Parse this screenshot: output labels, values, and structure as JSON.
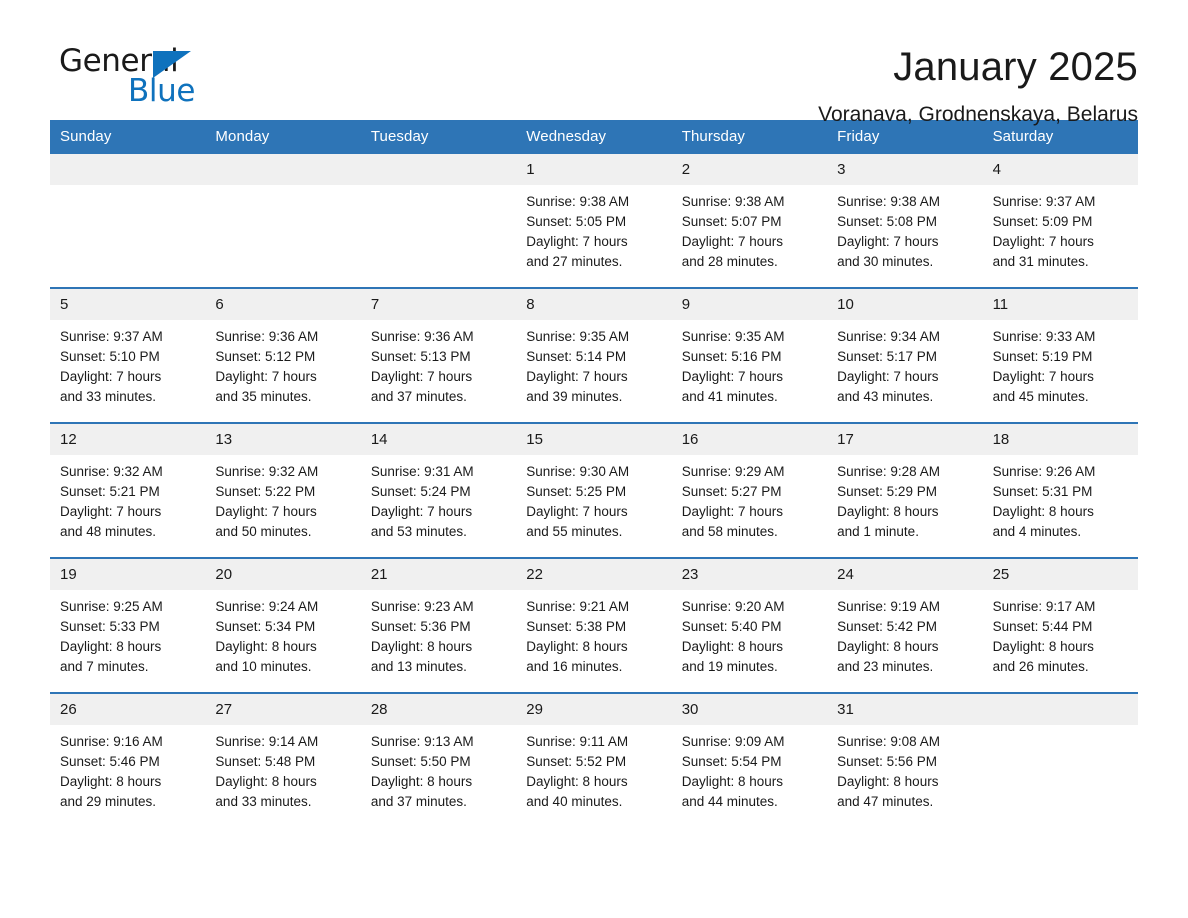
{
  "logo": {
    "word1": "General",
    "word2": "Blue",
    "triangle_icon": "triangle-icon",
    "accent_color": "#0f72bd"
  },
  "header": {
    "month_title": "January 2025",
    "location": "Voranava, Grodnenskaya, Belarus"
  },
  "theme": {
    "header_blue": "#2e75b6",
    "daynum_gray": "#f0f0f0",
    "text": "#1a1a1a"
  },
  "weekdays": [
    "Sunday",
    "Monday",
    "Tuesday",
    "Wednesday",
    "Thursday",
    "Friday",
    "Saturday"
  ],
  "weeks": [
    [
      {
        "day": "",
        "sunrise": "",
        "sunset": "",
        "daylight1": "",
        "daylight2": ""
      },
      {
        "day": "",
        "sunrise": "",
        "sunset": "",
        "daylight1": "",
        "daylight2": ""
      },
      {
        "day": "",
        "sunrise": "",
        "sunset": "",
        "daylight1": "",
        "daylight2": ""
      },
      {
        "day": "1",
        "sunrise": "Sunrise: 9:38 AM",
        "sunset": "Sunset: 5:05 PM",
        "daylight1": "Daylight: 7 hours",
        "daylight2": "and 27 minutes."
      },
      {
        "day": "2",
        "sunrise": "Sunrise: 9:38 AM",
        "sunset": "Sunset: 5:07 PM",
        "daylight1": "Daylight: 7 hours",
        "daylight2": "and 28 minutes."
      },
      {
        "day": "3",
        "sunrise": "Sunrise: 9:38 AM",
        "sunset": "Sunset: 5:08 PM",
        "daylight1": "Daylight: 7 hours",
        "daylight2": "and 30 minutes."
      },
      {
        "day": "4",
        "sunrise": "Sunrise: 9:37 AM",
        "sunset": "Sunset: 5:09 PM",
        "daylight1": "Daylight: 7 hours",
        "daylight2": "and 31 minutes."
      }
    ],
    [
      {
        "day": "5",
        "sunrise": "Sunrise: 9:37 AM",
        "sunset": "Sunset: 5:10 PM",
        "daylight1": "Daylight: 7 hours",
        "daylight2": "and 33 minutes."
      },
      {
        "day": "6",
        "sunrise": "Sunrise: 9:36 AM",
        "sunset": "Sunset: 5:12 PM",
        "daylight1": "Daylight: 7 hours",
        "daylight2": "and 35 minutes."
      },
      {
        "day": "7",
        "sunrise": "Sunrise: 9:36 AM",
        "sunset": "Sunset: 5:13 PM",
        "daylight1": "Daylight: 7 hours",
        "daylight2": "and 37 minutes."
      },
      {
        "day": "8",
        "sunrise": "Sunrise: 9:35 AM",
        "sunset": "Sunset: 5:14 PM",
        "daylight1": "Daylight: 7 hours",
        "daylight2": "and 39 minutes."
      },
      {
        "day": "9",
        "sunrise": "Sunrise: 9:35 AM",
        "sunset": "Sunset: 5:16 PM",
        "daylight1": "Daylight: 7 hours",
        "daylight2": "and 41 minutes."
      },
      {
        "day": "10",
        "sunrise": "Sunrise: 9:34 AM",
        "sunset": "Sunset: 5:17 PM",
        "daylight1": "Daylight: 7 hours",
        "daylight2": "and 43 minutes."
      },
      {
        "day": "11",
        "sunrise": "Sunrise: 9:33 AM",
        "sunset": "Sunset: 5:19 PM",
        "daylight1": "Daylight: 7 hours",
        "daylight2": "and 45 minutes."
      }
    ],
    [
      {
        "day": "12",
        "sunrise": "Sunrise: 9:32 AM",
        "sunset": "Sunset: 5:21 PM",
        "daylight1": "Daylight: 7 hours",
        "daylight2": "and 48 minutes."
      },
      {
        "day": "13",
        "sunrise": "Sunrise: 9:32 AM",
        "sunset": "Sunset: 5:22 PM",
        "daylight1": "Daylight: 7 hours",
        "daylight2": "and 50 minutes."
      },
      {
        "day": "14",
        "sunrise": "Sunrise: 9:31 AM",
        "sunset": "Sunset: 5:24 PM",
        "daylight1": "Daylight: 7 hours",
        "daylight2": "and 53 minutes."
      },
      {
        "day": "15",
        "sunrise": "Sunrise: 9:30 AM",
        "sunset": "Sunset: 5:25 PM",
        "daylight1": "Daylight: 7 hours",
        "daylight2": "and 55 minutes."
      },
      {
        "day": "16",
        "sunrise": "Sunrise: 9:29 AM",
        "sunset": "Sunset: 5:27 PM",
        "daylight1": "Daylight: 7 hours",
        "daylight2": "and 58 minutes."
      },
      {
        "day": "17",
        "sunrise": "Sunrise: 9:28 AM",
        "sunset": "Sunset: 5:29 PM",
        "daylight1": "Daylight: 8 hours",
        "daylight2": "and 1 minute."
      },
      {
        "day": "18",
        "sunrise": "Sunrise: 9:26 AM",
        "sunset": "Sunset: 5:31 PM",
        "daylight1": "Daylight: 8 hours",
        "daylight2": "and 4 minutes."
      }
    ],
    [
      {
        "day": "19",
        "sunrise": "Sunrise: 9:25 AM",
        "sunset": "Sunset: 5:33 PM",
        "daylight1": "Daylight: 8 hours",
        "daylight2": "and 7 minutes."
      },
      {
        "day": "20",
        "sunrise": "Sunrise: 9:24 AM",
        "sunset": "Sunset: 5:34 PM",
        "daylight1": "Daylight: 8 hours",
        "daylight2": "and 10 minutes."
      },
      {
        "day": "21",
        "sunrise": "Sunrise: 9:23 AM",
        "sunset": "Sunset: 5:36 PM",
        "daylight1": "Daylight: 8 hours",
        "daylight2": "and 13 minutes."
      },
      {
        "day": "22",
        "sunrise": "Sunrise: 9:21 AM",
        "sunset": "Sunset: 5:38 PM",
        "daylight1": "Daylight: 8 hours",
        "daylight2": "and 16 minutes."
      },
      {
        "day": "23",
        "sunrise": "Sunrise: 9:20 AM",
        "sunset": "Sunset: 5:40 PM",
        "daylight1": "Daylight: 8 hours",
        "daylight2": "and 19 minutes."
      },
      {
        "day": "24",
        "sunrise": "Sunrise: 9:19 AM",
        "sunset": "Sunset: 5:42 PM",
        "daylight1": "Daylight: 8 hours",
        "daylight2": "and 23 minutes."
      },
      {
        "day": "25",
        "sunrise": "Sunrise: 9:17 AM",
        "sunset": "Sunset: 5:44 PM",
        "daylight1": "Daylight: 8 hours",
        "daylight2": "and 26 minutes."
      }
    ],
    [
      {
        "day": "26",
        "sunrise": "Sunrise: 9:16 AM",
        "sunset": "Sunset: 5:46 PM",
        "daylight1": "Daylight: 8 hours",
        "daylight2": "and 29 minutes."
      },
      {
        "day": "27",
        "sunrise": "Sunrise: 9:14 AM",
        "sunset": "Sunset: 5:48 PM",
        "daylight1": "Daylight: 8 hours",
        "daylight2": "and 33 minutes."
      },
      {
        "day": "28",
        "sunrise": "Sunrise: 9:13 AM",
        "sunset": "Sunset: 5:50 PM",
        "daylight1": "Daylight: 8 hours",
        "daylight2": "and 37 minutes."
      },
      {
        "day": "29",
        "sunrise": "Sunrise: 9:11 AM",
        "sunset": "Sunset: 5:52 PM",
        "daylight1": "Daylight: 8 hours",
        "daylight2": "and 40 minutes."
      },
      {
        "day": "30",
        "sunrise": "Sunrise: 9:09 AM",
        "sunset": "Sunset: 5:54 PM",
        "daylight1": "Daylight: 8 hours",
        "daylight2": "and 44 minutes."
      },
      {
        "day": "31",
        "sunrise": "Sunrise: 9:08 AM",
        "sunset": "Sunset: 5:56 PM",
        "daylight1": "Daylight: 8 hours",
        "daylight2": "and 47 minutes."
      },
      {
        "day": "",
        "sunrise": "",
        "sunset": "",
        "daylight1": "",
        "daylight2": ""
      }
    ]
  ]
}
